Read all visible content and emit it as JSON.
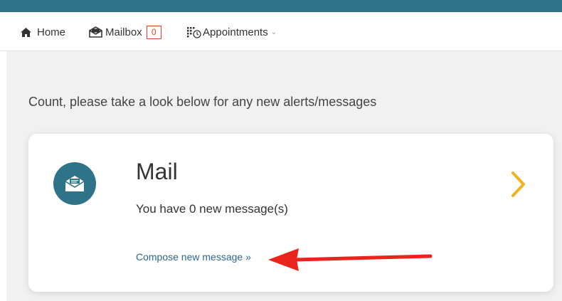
{
  "nav": {
    "home_label": "Home",
    "mailbox_label": "Mailbox",
    "mailbox_count": "0",
    "appointments_label": "Appointments",
    "caret": "⌄"
  },
  "greeting": "Count, please take a look below for any new alerts/messages",
  "mail_card": {
    "title": "Mail",
    "message": "You have 0 new message(s)",
    "compose_link": "Compose new message »"
  },
  "colors": {
    "brand": "#2e7388",
    "badge": "#e04030",
    "chevron": "#f2b21b",
    "annotation_arrow": "#e8241c",
    "link": "#2e6590"
  },
  "icons": [
    "home-icon",
    "mailbox-icon",
    "appointments-icon",
    "mail-envelope-icon",
    "chevron-right-icon"
  ]
}
